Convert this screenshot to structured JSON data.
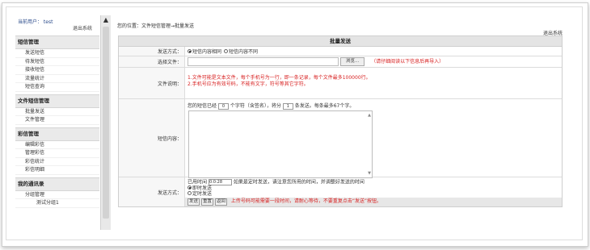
{
  "sidebar": {
    "user_label": "当前用户： test",
    "logout": "退出系统",
    "sections": [
      {
        "title": "短信管理",
        "items": [
          "发送短信",
          "待发短信",
          "接收短信",
          "流量统计",
          "短信查询"
        ]
      },
      {
        "title": "文件短信管理",
        "items": [
          "批量发送",
          "文件管理"
        ]
      },
      {
        "title": "彩信管理",
        "items": [
          "编辑彩信",
          "管理彩信",
          "彩信统计",
          "彩信明细"
        ]
      },
      {
        "title": "我的通讯录",
        "items": [
          "分组管理"
        ],
        "subitems": [
          "测试分组1"
        ]
      }
    ]
  },
  "main": {
    "breadcrumb": "您的位置：文件短信管理→批量发送",
    "logout": "退出系统",
    "panel_title": "批量发送",
    "send_mode": {
      "label": "发送方式：",
      "opt1": "短信内容相同",
      "opt2": "短信内容不同"
    },
    "file": {
      "label": "选择文件：",
      "browse": "浏览...",
      "hint": "（请仔细阅读以下信息后再导入）"
    },
    "file_desc": {
      "label": "文件说明：",
      "line1": "1.文件可能是文本文件，每个手机号为一行，即一条记录，每个文件最多100000行。",
      "line2": "2.手机号应为有效号码，不能有文字，符号等其它字符。"
    },
    "content": {
      "label": "短信内容：",
      "count_prefix": "您的短信已经",
      "count_value": "0",
      "count_mid": "个字符（含签名），将分",
      "parts_value": "1",
      "count_suffix": "条发送。每条最多67个字。"
    },
    "send_time": {
      "label": "发送方式：",
      "used_prefix": "已用时间",
      "used_value": "0:0:28",
      "used_suffix": "如果是定时发送，请注意您所用的时间，并调整好发送的时间",
      "opt1": "即时发送",
      "opt2": "定时发送"
    },
    "actions": {
      "send": "发送",
      "reset": "重置",
      "back": "返回",
      "warning": "上传号码可能需要一段时间，请耐心等待，不要重复点击“发送”按钮。"
    }
  }
}
